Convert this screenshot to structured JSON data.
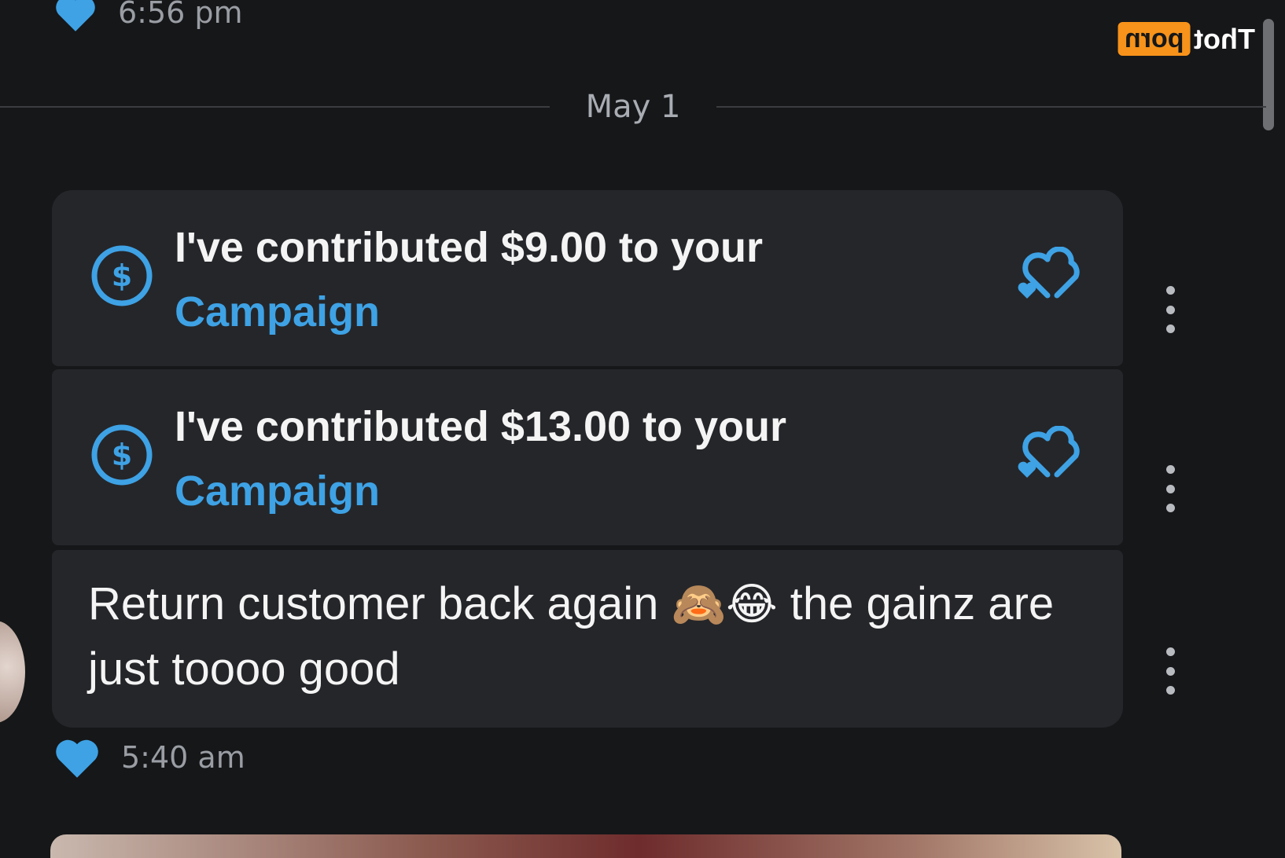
{
  "watermark": {
    "box": "porn",
    "text": "Thot"
  },
  "top_meta": {
    "time": "6:56 pm",
    "icon": "heart-icon"
  },
  "date_divider": {
    "label": "May 1"
  },
  "messages": [
    {
      "text": "I've contributed $9.00 to your",
      "link": "Campaign",
      "icon": "dollar-circle-icon",
      "action_icon": "double-heart-icon"
    },
    {
      "text": "I've contributed $13.00 to your",
      "link": "Campaign",
      "icon": "dollar-circle-icon",
      "action_icon": "double-heart-icon"
    },
    {
      "text_before_emoji": "Return customer back again",
      "emoji_1": "🙈",
      "emoji_2": "😂",
      "text_after_emoji": "the gainz are just toooo good"
    }
  ],
  "bottom_meta": {
    "time": "5:40 am",
    "icon": "heart-icon"
  },
  "colors": {
    "accent": "#3ea2e5",
    "background": "#161719",
    "bubble": "#25262a",
    "watermark": "#f7931a"
  }
}
